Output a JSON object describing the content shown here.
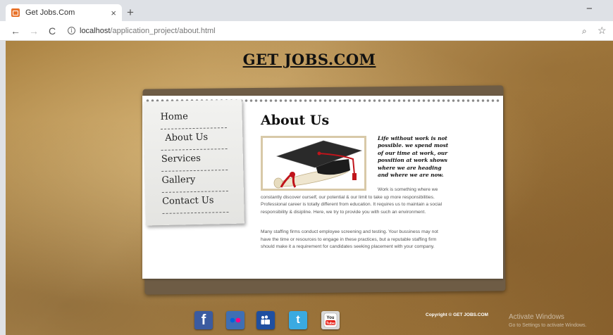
{
  "browser": {
    "tab_title": "Get Jobs.Com",
    "tab_close": "×",
    "new_tab": "+",
    "minimize": "−",
    "url_host": "localhost",
    "url_path": "/application_project/about.html"
  },
  "site": {
    "title": "GET JOBS.COM"
  },
  "nav": {
    "items": [
      "Home",
      "About Us",
      "Services",
      "Gallery",
      "Contact Us"
    ],
    "active": "About Us"
  },
  "content": {
    "heading": "About Us",
    "quote": "Life without work is not possible. we spend most of our time at work, our possition at work shows where we are heading and where we are now.",
    "para1": "Work is something where we constantly discover ourself, our potential & our limit to take up more responsibilities. Professional career is totally different from education. It requires us to maintain a social responsibility & disipline. Here, we try to provide you with such an environment.",
    "para2": "Many staffing firms conduct employee screening and testing. Your bussiness may not have the time or resources to engage in these practices, but a reputable staffing firm should make it a requirement for candidates seeking placement with your company."
  },
  "footer": {
    "social": [
      "facebook-icon",
      "flickr-icon",
      "myspace-icon",
      "twitter-icon",
      "youtube-icon"
    ],
    "youtube_label": "You Tube",
    "copyright_prefix": "Copyright ©",
    "copyright_link": "GET JOBS.COM"
  },
  "os": {
    "watermark_title": "Activate Windows",
    "watermark_sub": "Go to Settings to activate Windows."
  },
  "colors": {
    "facebook": "#3b5ba0",
    "twitter": "#3aaae1",
    "cap_tassel": "#c0141b"
  }
}
